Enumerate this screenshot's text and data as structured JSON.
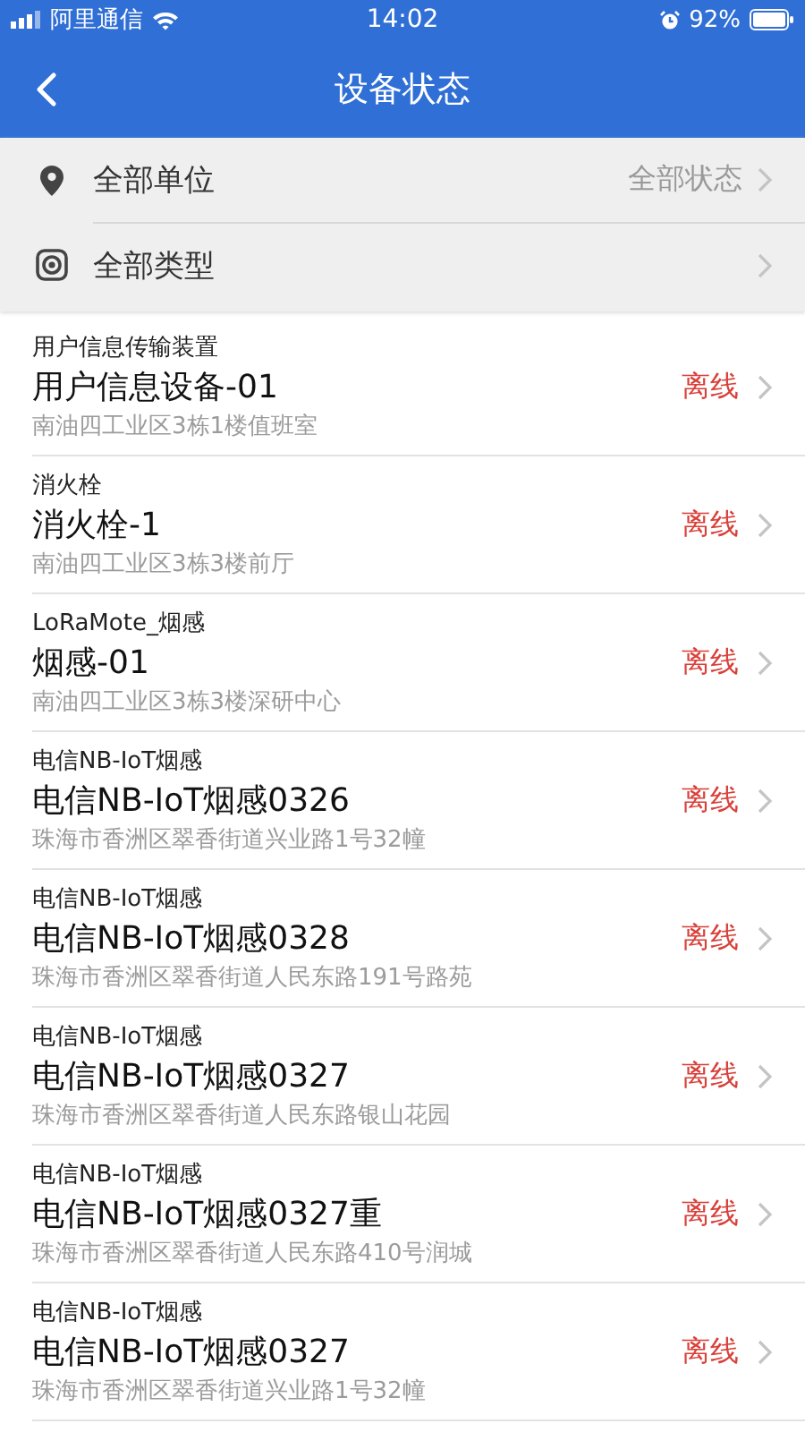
{
  "status_bar": {
    "carrier": "阿里通信",
    "time": "14:02",
    "battery": "92%"
  },
  "nav": {
    "title": "设备状态"
  },
  "filters": [
    {
      "kind": "location",
      "label": "全部单位",
      "value": "全部状态"
    },
    {
      "kind": "type",
      "label": "全部类型"
    }
  ],
  "devices": [
    {
      "type": "用户信息传输装置",
      "name": "用户信息设备-01",
      "address": "南油四工业区3栋1楼值班室",
      "status": "离线",
      "online": false
    },
    {
      "type": "消火栓",
      "name": "消火栓-1",
      "address": "南油四工业区3栋3楼前厅",
      "status": "离线",
      "online": false
    },
    {
      "type": "LoRaMote_烟感",
      "name": "烟感-01",
      "address": "南油四工业区3栋3楼深研中心",
      "status": "离线",
      "online": false
    },
    {
      "type": "电信NB-IoT烟感",
      "name": "电信NB-IoT烟感0326",
      "address": "珠海市香洲区翠香街道兴业路1号32幢",
      "status": "离线",
      "online": false
    },
    {
      "type": "电信NB-IoT烟感",
      "name": "电信NB-IoT烟感0328",
      "address": "珠海市香洲区翠香街道人民东路191号路苑",
      "status": "离线",
      "online": false
    },
    {
      "type": "电信NB-IoT烟感",
      "name": "电信NB-IoT烟感0327",
      "address": "珠海市香洲区翠香街道人民东路银山花园",
      "status": "离线",
      "online": false
    },
    {
      "type": "电信NB-IoT烟感",
      "name": "电信NB-IoT烟感0327重",
      "address": "珠海市香洲区翠香街道人民东路410号润城",
      "status": "离线",
      "online": false
    },
    {
      "type": "电信NB-IoT烟感",
      "name": "电信NB-IoT烟感0327",
      "address": "珠海市香洲区翠香街道兴业路1号32幢",
      "status": "离线",
      "online": false
    }
  ]
}
